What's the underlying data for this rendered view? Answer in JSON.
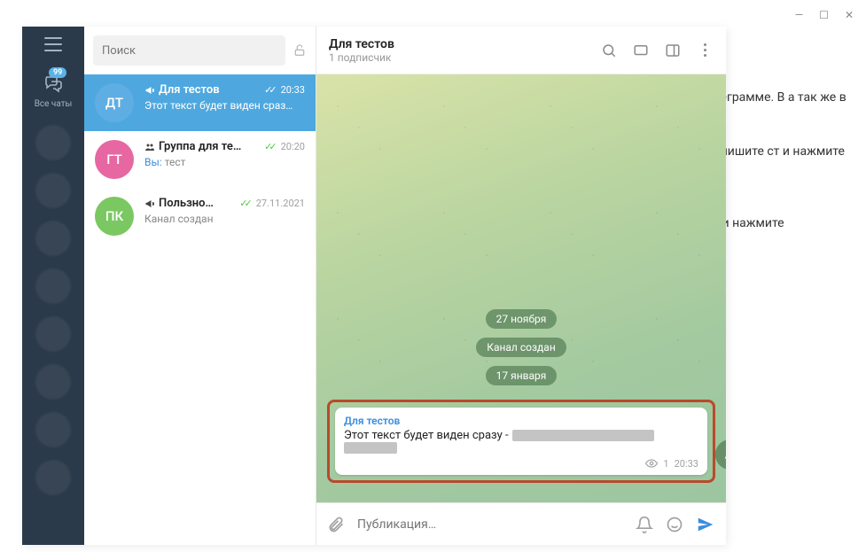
{
  "window_controls": {
    "minimize": "—",
    "maximize": "☐",
    "close": "✕"
  },
  "background_text": {
    "p1": "елеграмме. В а так же в",
    "p2": "напишите ст и нажмите",
    "p3": "ст и нажмите"
  },
  "rail": {
    "all_chats_label": "Все чаты",
    "badge": "99"
  },
  "search": {
    "placeholder": "Поиск"
  },
  "chats": [
    {
      "initials": "ДТ",
      "avatar_color": "#5faee3",
      "name": "Для тестов",
      "time": "20:33",
      "preview": "Этот текст будет виден сраз…",
      "selected": true,
      "type": "channel"
    },
    {
      "initials": "ГТ",
      "avatar_color": "#e667a1",
      "name": "Группа для те…",
      "time": "20:20",
      "you": "Вы:",
      "preview": "тест",
      "selected": false,
      "type": "group"
    },
    {
      "initials": "ПК",
      "avatar_color": "#7bc862",
      "name": "Пользно…",
      "time": "27.11.2021",
      "preview": "Канал создан",
      "preview_link": true,
      "selected": false,
      "type": "channel"
    }
  ],
  "conversation": {
    "title": "Для тестов",
    "subtitle": "1 подписчик",
    "service": {
      "date1": "27 ноября",
      "created": "Канал создан",
      "date2": "17 января"
    },
    "message": {
      "from": "Для тестов",
      "text": "Этот текст будет виден сразу -",
      "views": "1",
      "time": "20:33"
    },
    "composer_placeholder": "Публикация…"
  }
}
